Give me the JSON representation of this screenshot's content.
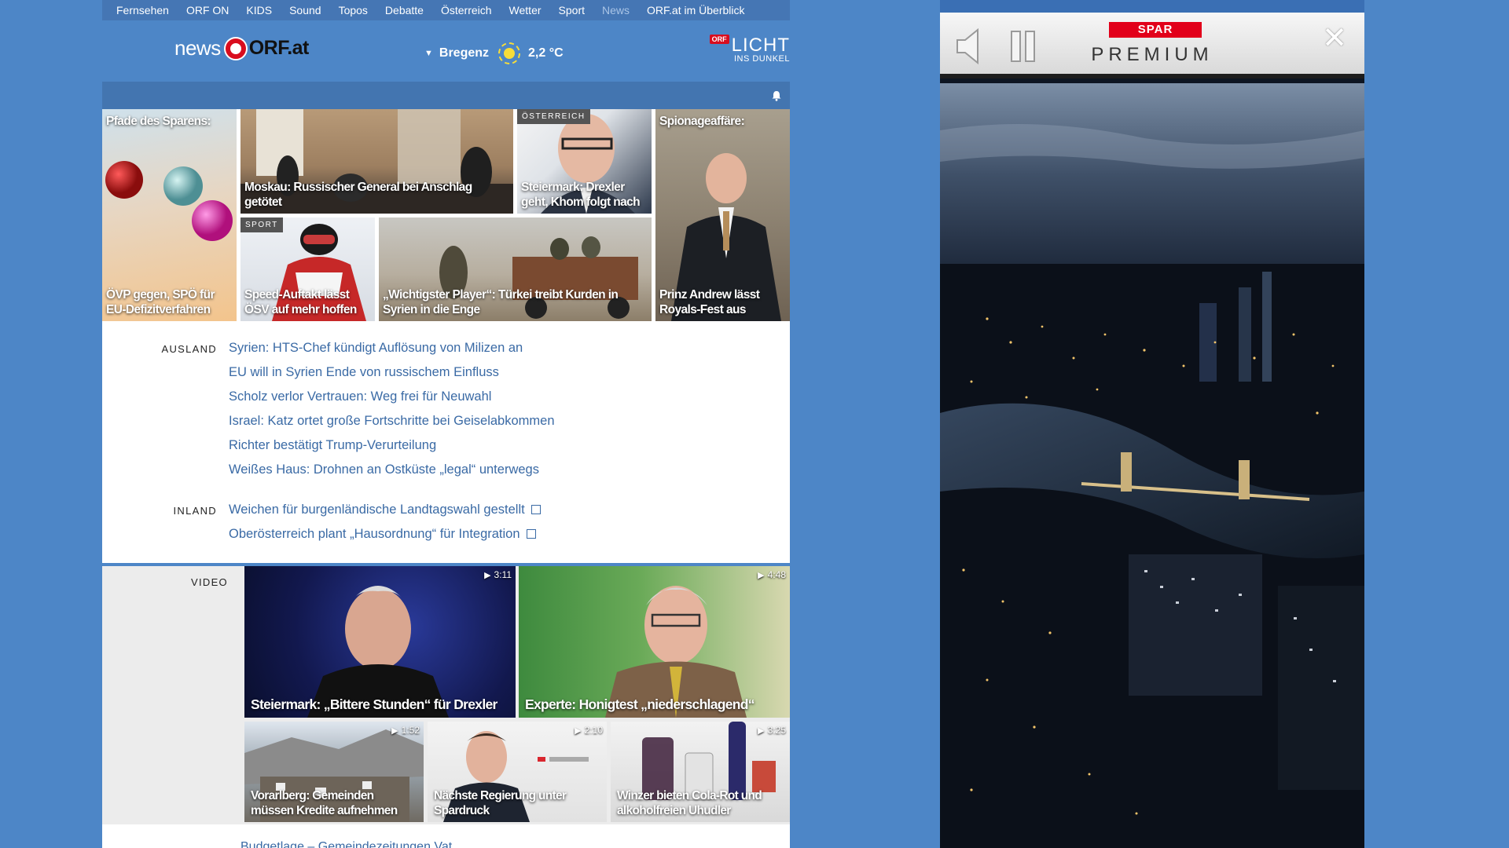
{
  "topnav": {
    "items": [
      "Fernsehen",
      "ORF ON",
      "KIDS",
      "Sound",
      "Topos",
      "Debatte",
      "Österreich",
      "Wetter",
      "Sport",
      "News",
      "ORF.at im Überblick"
    ]
  },
  "header": {
    "logo_news": "news",
    "logo_orf": "ORF.at",
    "weather_location": "Bregenz",
    "weather_temp": "2,2 °C",
    "licht_badge": "ORF",
    "licht_title": "LICHT",
    "licht_sub": "INS DUNKEL"
  },
  "teasers": {
    "sparen_top": "Pfade des Sparens:",
    "sparen_bottom": "ÖVP gegen, SPÖ für EU-Defizitverfahren",
    "moskau": "Moskau: Russischer General bei Anschlag getötet",
    "steiermark_tag": "ÖSTERREICH",
    "steiermark": "Steiermark: Drexler geht, Khom folgt nach",
    "spionage_top": "Spionageaffäre:",
    "spionage_bottom": "Prinz Andrew lässt Royals-Fest aus",
    "sport_tag": "SPORT",
    "sport": "Speed-Auftakt lässt ÖSV auf mehr hoffen",
    "tuerkei": "„Wichtigster Player“: Türkei treibt Kurden in Syrien in die Enge"
  },
  "ausland": {
    "label": "AUSLAND",
    "items": [
      "Syrien: HTS-Chef kündigt Auflösung von Milizen an",
      "EU will in Syrien Ende von russischem Einfluss",
      "Scholz verlor Vertrauen: Weg frei für Neuwahl",
      "Israel: Katz ortet große Fortschritte bei Geiselabkommen",
      "Richter bestätigt Trump-Verurteilung",
      "Weißes Haus: Drohnen an Ostküste „legal“ unterwegs"
    ]
  },
  "inland": {
    "label": "INLAND",
    "items": [
      "Weichen für burgenländische Landtagswahl gestellt",
      "Oberösterreich plant „Hausordnung“ für Integration"
    ]
  },
  "video": {
    "label": "VIDEO",
    "items": [
      {
        "title": "Steiermark: „Bittere Stunden“ für Drexler",
        "duration": "3:11"
      },
      {
        "title": "Experte: Honigtest „niederschlagend“",
        "duration": "4:48"
      },
      {
        "title": "Vorarlberg: Gemeinden müssen Kredite aufnehmen",
        "duration": "1:52"
      },
      {
        "title": "Nächste Regierung unter Spardruck",
        "duration": "2:10"
      },
      {
        "title": "Winzer bieten Cola-Rot und alkoholfreien Uhudler",
        "duration": "3:25"
      }
    ]
  },
  "below_text": "Budgetlage – Gemeindezeitungen Vat…",
  "ad": {
    "brand": "SPAR",
    "title": "PREMIUM",
    "close": "✕"
  },
  "colors": {
    "background": "#4d86c7",
    "link": "#3a6aa5",
    "orf_red": "#d90d1e",
    "spar_red": "#e2001a"
  }
}
